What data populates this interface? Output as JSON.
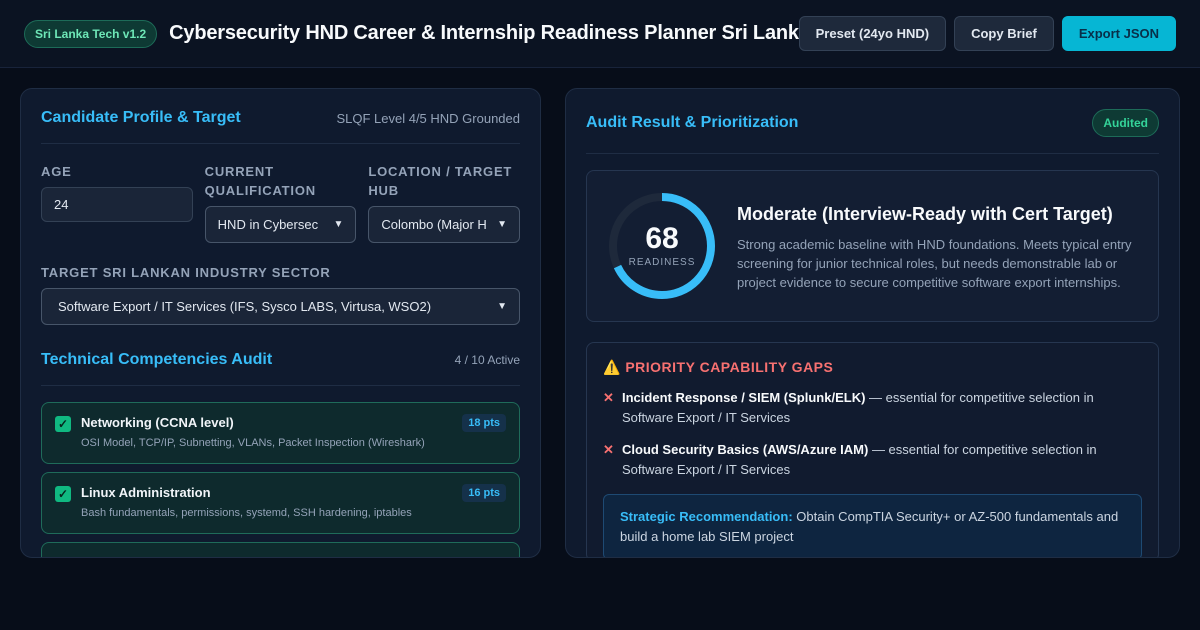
{
  "header": {
    "badge": "Sri Lanka Tech v1.2",
    "title": "Cybersecurity HND Career & Internship Readiness Planner Sri Lanka",
    "buttons": {
      "preset": "Preset (24yo HND)",
      "copy": "Copy Brief",
      "export": "Export JSON"
    }
  },
  "profile": {
    "title": "Candidate Profile & Target",
    "meta": "SLQF Level 4/5 HND Grounded",
    "age_label": "Age",
    "age_value": "24",
    "qual_label": "Current Qualification",
    "qual_value": "HND in Cybersec",
    "loc_label": "Location / Target Hub",
    "loc_value": "Colombo (Major H",
    "sector_label": "Target Sri Lankan Industry Sector",
    "sector_value": "Software Export / IT Services (IFS, Sysco LABS, Virtusa, WSO2)"
  },
  "competencies": {
    "title": "Technical Competencies Audit",
    "meta": "4 / 10 Active",
    "items": [
      {
        "name": "Networking (CCNA level)",
        "desc": "OSI Model, TCP/IP, Subnetting, VLANs, Packet Inspection (Wireshark)",
        "pts": "18 pts",
        "checked": true
      },
      {
        "name": "Linux Administration",
        "desc": "Bash fundamentals, permissions, systemd, SSH hardening, iptables",
        "pts": "16 pts",
        "checked": true
      }
    ]
  },
  "audit": {
    "title": "Audit Result & Prioritization",
    "status": "Audited",
    "score": "68",
    "score_value": 68,
    "score_max": 100,
    "score_label": "READINESS",
    "verdict": "Moderate (Interview-Ready with Cert Target)",
    "verdict_desc": "Strong academic baseline with HND foundations. Meets typical entry screening for junior technical roles, but needs demonstrable lab or project evidence to secure competitive software export internships.",
    "gaps_icon": "warning-icon",
    "gaps_title": "PRIORITY CAPABILITY GAPS",
    "gaps": [
      {
        "name": "Incident Response / SIEM (Splunk/ELK)",
        "rest": " — essential for competitive selection in Software Export / IT Services"
      },
      {
        "name": "Cloud Security Basics (AWS/Azure IAM)",
        "rest": " — essential for competitive selection in Software Export / IT Services"
      }
    ],
    "rec_label": "Strategic Recommendation:",
    "rec_text": " Obtain CompTIA Security+ or AZ-500 fundamentals and build a home lab SIEM project"
  },
  "colors": {
    "accent": "#38bdf8",
    "success": "#10b981",
    "danger": "#f87171",
    "primary_button": "#06b6d4"
  }
}
